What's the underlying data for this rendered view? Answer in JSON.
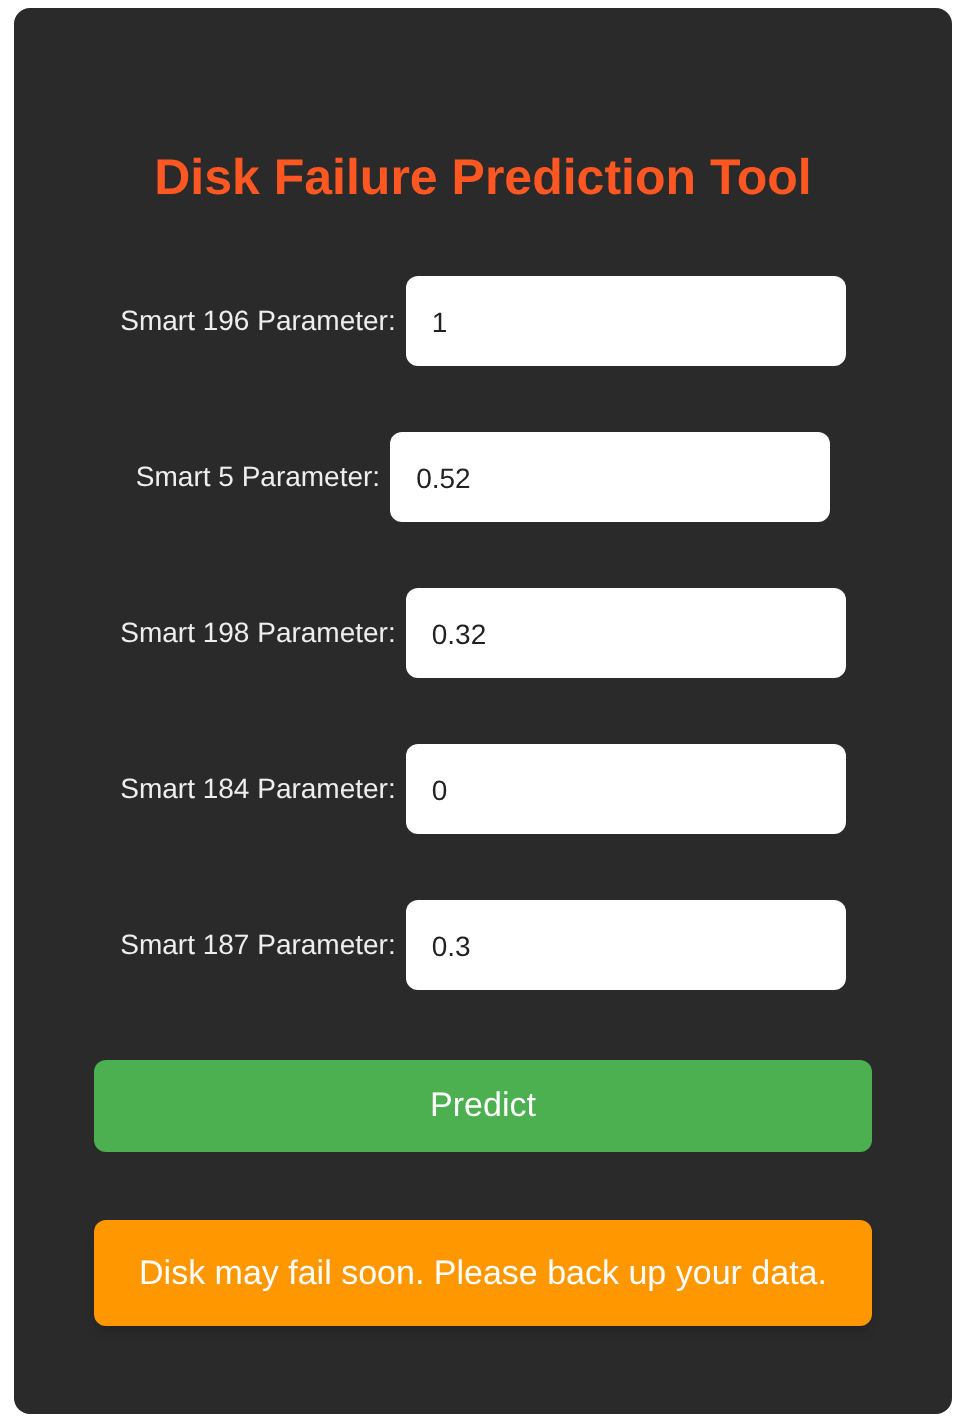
{
  "title": "Disk Failure Prediction Tool",
  "fields": [
    {
      "label": "Smart 196 Parameter:",
      "value": "1"
    },
    {
      "label": "Smart 5 Parameter:",
      "value": "0.52"
    },
    {
      "label": "Smart 198 Parameter:",
      "value": "0.32"
    },
    {
      "label": "Smart 184 Parameter:",
      "value": "0"
    },
    {
      "label": "Smart 187 Parameter:",
      "value": "0.3"
    }
  ],
  "button": "Predict",
  "result": {
    "kind": "warning",
    "text": "Disk may fail soon. Please back up your data."
  }
}
